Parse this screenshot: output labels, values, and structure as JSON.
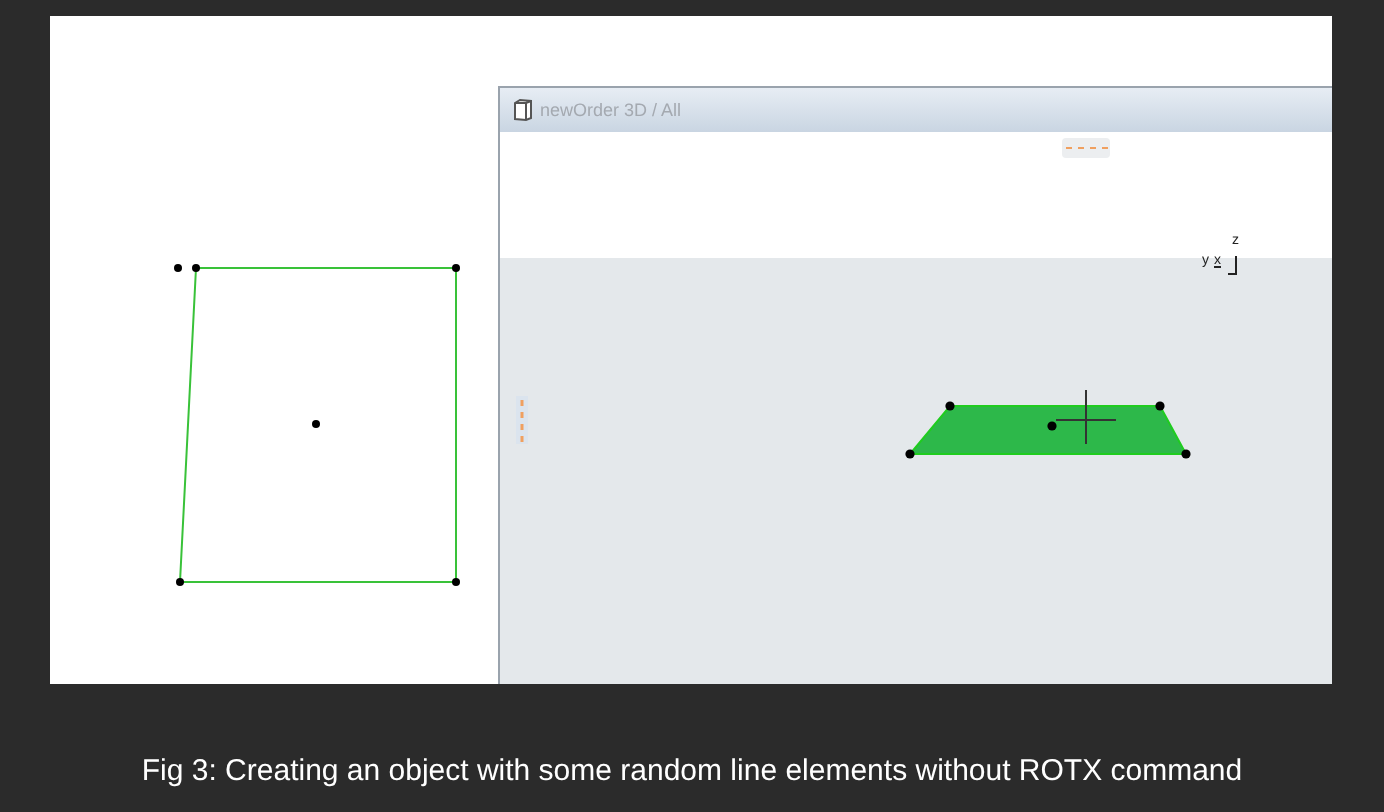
{
  "window": {
    "title": "newOrder 3D / All"
  },
  "axes": {
    "z": "z",
    "y": "y",
    "x": "x"
  },
  "caption": "Fig 3: Creating an object with some random line elements without ROTX command"
}
